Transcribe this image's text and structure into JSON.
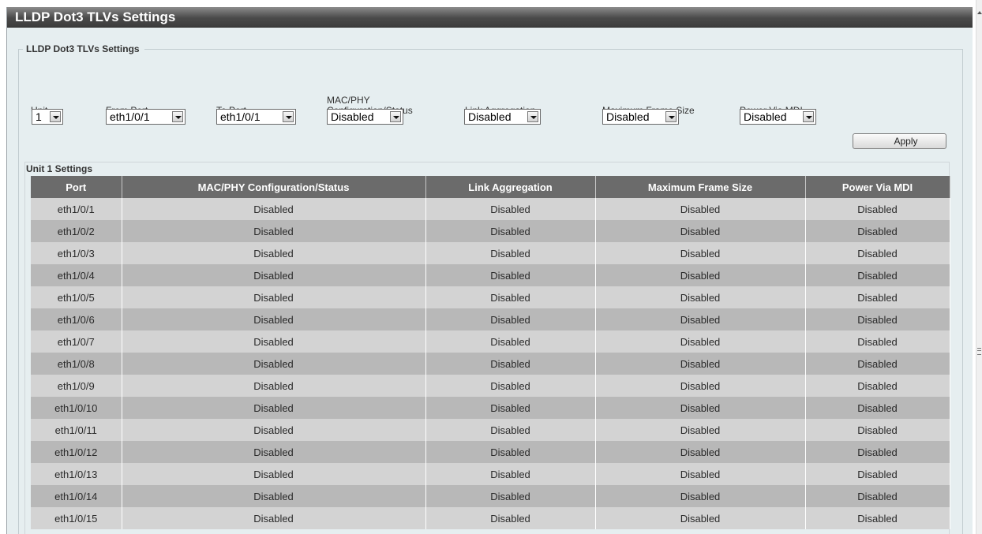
{
  "page": {
    "title": "LLDP Dot3 TLVs Settings",
    "section_legend": "LLDP Dot3 TLVs Settings"
  },
  "form": {
    "unit": {
      "label": "Unit",
      "value": "1"
    },
    "from_port": {
      "label": "From Port",
      "value": "eth1/0/1"
    },
    "to_port": {
      "label": "To Port",
      "value": "eth1/0/1"
    },
    "mac_phy": {
      "label_line1": "MAC/PHY",
      "label_line2": "Configuration/Status",
      "value": "Disabled"
    },
    "link_aggregation": {
      "label": "Link Aggregation",
      "value": "Disabled"
    },
    "max_frame_size": {
      "label": "Maximum Frame Size",
      "value": "Disabled"
    },
    "power_via_mdi": {
      "label": "Power Via MDI",
      "value": "Disabled"
    },
    "apply_label": "Apply"
  },
  "unit_settings": {
    "title": "Unit 1 Settings",
    "columns": [
      "Port",
      "MAC/PHY Configuration/Status",
      "Link Aggregation",
      "Maximum Frame Size",
      "Power Via MDI"
    ],
    "rows": [
      [
        "eth1/0/1",
        "Disabled",
        "Disabled",
        "Disabled",
        "Disabled"
      ],
      [
        "eth1/0/2",
        "Disabled",
        "Disabled",
        "Disabled",
        "Disabled"
      ],
      [
        "eth1/0/3",
        "Disabled",
        "Disabled",
        "Disabled",
        "Disabled"
      ],
      [
        "eth1/0/4",
        "Disabled",
        "Disabled",
        "Disabled",
        "Disabled"
      ],
      [
        "eth1/0/5",
        "Disabled",
        "Disabled",
        "Disabled",
        "Disabled"
      ],
      [
        "eth1/0/6",
        "Disabled",
        "Disabled",
        "Disabled",
        "Disabled"
      ],
      [
        "eth1/0/7",
        "Disabled",
        "Disabled",
        "Disabled",
        "Disabled"
      ],
      [
        "eth1/0/8",
        "Disabled",
        "Disabled",
        "Disabled",
        "Disabled"
      ],
      [
        "eth1/0/9",
        "Disabled",
        "Disabled",
        "Disabled",
        "Disabled"
      ],
      [
        "eth1/0/10",
        "Disabled",
        "Disabled",
        "Disabled",
        "Disabled"
      ],
      [
        "eth1/0/11",
        "Disabled",
        "Disabled",
        "Disabled",
        "Disabled"
      ],
      [
        "eth1/0/12",
        "Disabled",
        "Disabled",
        "Disabled",
        "Disabled"
      ],
      [
        "eth1/0/13",
        "Disabled",
        "Disabled",
        "Disabled",
        "Disabled"
      ],
      [
        "eth1/0/14",
        "Disabled",
        "Disabled",
        "Disabled",
        "Disabled"
      ],
      [
        "eth1/0/15",
        "Disabled",
        "Disabled",
        "Disabled",
        "Disabled"
      ]
    ]
  },
  "colors": {
    "page_background": "#e6eef0",
    "title_bar": "#4a4a4a",
    "table_header": "#6b6b6b",
    "row_light": "#d3d3d3",
    "row_dark": "#b8b8b8"
  },
  "icons": {
    "dropdown": "chevron-down-icon",
    "scroll_up": "scroll-up-arrow-icon",
    "scroll_grip": "scroll-grip-icon"
  }
}
